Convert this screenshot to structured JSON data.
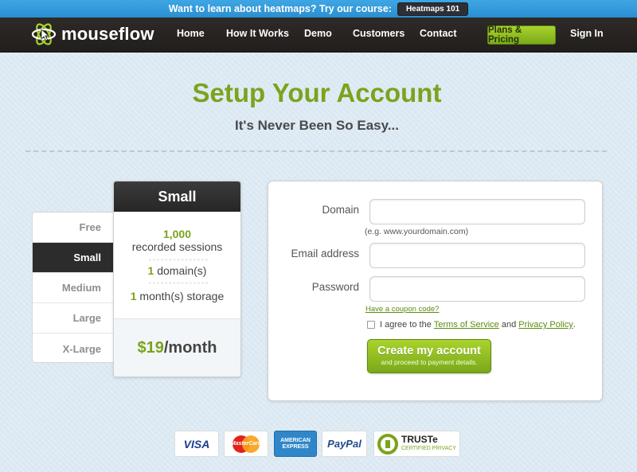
{
  "promo": {
    "text": "Want to learn about heatmaps? Try our course:",
    "button": "Heatmaps 101"
  },
  "nav": {
    "logo_text": "mouseflow",
    "links": [
      "Home",
      "How It Works",
      "Demo",
      "Customers",
      "Contact"
    ],
    "cta": "Plans & Pricing",
    "signin": "Sign In"
  },
  "header": {
    "title": "Setup Your Account",
    "subtitle": "It's Never Been So Easy..."
  },
  "plans": {
    "tabs": [
      "Free",
      "Small",
      "Medium",
      "Large",
      "X-Large"
    ],
    "selected": "Small",
    "card": {
      "name": "Small",
      "sessions_num": "1,000",
      "sessions_label": "recorded sessions",
      "domains_num": "1",
      "domains_label": "domain(s)",
      "storage_num": "1",
      "storage_label": "month(s) storage",
      "price_amount": "$19",
      "price_period": "/month"
    }
  },
  "form": {
    "domain_label": "Domain",
    "domain_value": "",
    "domain_hint": "(e.g. www.yourdomain.com)",
    "email_label": "Email address",
    "email_value": "",
    "password_label": "Password",
    "password_value": "",
    "coupon_link": "Have a coupon code?",
    "agree_prefix": "I agree to the ",
    "terms_link": "Terms of Service",
    "agree_and": " and ",
    "privacy_link": "Privacy Policy",
    "agree_suffix": ".",
    "agree_checked": false,
    "submit_main": "Create my account",
    "submit_sub": "and proceed to payment details."
  },
  "payments": {
    "visa": "VISA",
    "mastercard": "MasterCard",
    "amex_line1": "AMERICAN",
    "amex_line2": "EXPRESS",
    "paypal": "PayPal",
    "truste": "TRUSTe",
    "truste_sub": "CERTIFIED PRIVACY"
  },
  "colors": {
    "accent_green": "#7ba31d",
    "nav_dark": "#2e2a27",
    "promo_blue": "#3fa6e3"
  }
}
